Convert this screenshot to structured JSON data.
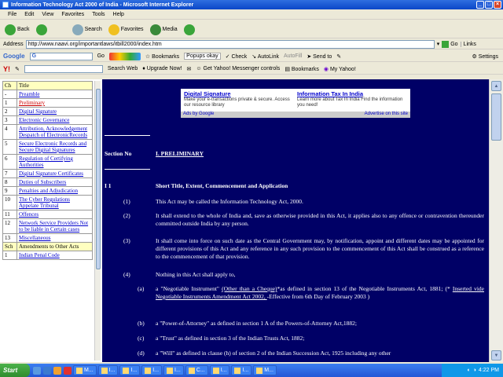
{
  "window": {
    "title": "Information Technology Act 2000 of India - Microsoft Internet Explorer"
  },
  "menu": [
    "File",
    "Edit",
    "View",
    "Favorites",
    "Tools",
    "Help"
  ],
  "toolbar": {
    "back": "Back",
    "search": "Search",
    "favorites": "Favorites",
    "media": "Media"
  },
  "address": {
    "label": "Address",
    "url": "http://www.naavi.org/importantlaws/itbill2000/index.htm",
    "go": "Go",
    "links": "Links"
  },
  "google_bar": {
    "brand": "Google",
    "input_prefix": "G",
    "go": "Go",
    "bookmarks": "Bookmarks",
    "popups": "Popups okay",
    "check": "Check",
    "autolink": "AutoLink",
    "autofill": "AutoFill",
    "sendto": "Send to",
    "settings": "Settings"
  },
  "yahoo_bar": {
    "brand": "Y!",
    "search_web": "Search Web",
    "upgrade": "Upgrade Now!",
    "messenger": "Get Yahoo! Messenger controls",
    "bookmarks": "Bookmarks",
    "my_yahoo": "My Yahoo!"
  },
  "toc": {
    "header": {
      "ch": "Ch",
      "title": "Title"
    },
    "rows": [
      {
        "n": "-",
        "title": "Preamble"
      },
      {
        "n": "1",
        "title": "Preliminary",
        "active": true
      },
      {
        "n": "2",
        "title": "Digital Signature"
      },
      {
        "n": "3",
        "title": "Electronic Governance"
      },
      {
        "n": "4",
        "title": "Attribution, Acknowledgement Despatch of ElectronicRecords"
      },
      {
        "n": "5",
        "title": "Secure Electronic Records and Secure Digital Signatures"
      },
      {
        "n": "6",
        "title": "Regulation of Certifying Authorities"
      },
      {
        "n": "7",
        "title": "Digital Signature Certificates"
      },
      {
        "n": "8",
        "title": "Duties of Subscribers"
      },
      {
        "n": "9",
        "title": "Penalties and Adjudication"
      },
      {
        "n": "10",
        "title": "The Cyber Regulations Appelate Tribunal"
      },
      {
        "n": "11",
        "title": "Offences"
      },
      {
        "n": "12",
        "title": "Network Service Providers Not to be liable in Certain cases"
      },
      {
        "n": "13",
        "title": "Miscellaneous"
      }
    ],
    "sch_header": {
      "ch": "Sch",
      "title": "Amendments to Other Acts"
    },
    "sch_rows": [
      {
        "n": "1",
        "title": "Indian Penal Code"
      }
    ]
  },
  "ad": {
    "left_title": "Digital Signature",
    "left_text": "Make your e-transactions private & secure. Access our resource library",
    "right_title": "Information Tax In India",
    "right_text": "Learn more about Tax In India Find the information you need!",
    "ads_by": "Ads by Google",
    "advertise": "Advertise on this site"
  },
  "section": {
    "label": "Section No",
    "title": "I. PRELIMINARY"
  },
  "clause": {
    "num": "I    1",
    "heading": "Short Title, Extent, Commencement and Application"
  },
  "paras": [
    {
      "num": "(1)",
      "text": "This Act may be called the Information Technology Act, 2000."
    },
    {
      "num": "(2)",
      "text": "It shall extend to the whole of India and, save as otherwise provided in this Act, it applies also to any offence or contravention thereunder committed outside India by any person."
    },
    {
      "num": "(3)",
      "text": "It shall come into force on such date as the Central Government may, by notification, appoint and different dates may be appointed for different provisions of this Act and any reference in any such provision to the commencement of this Act shall be construed as a reference to the commencement of that provision."
    },
    {
      "num": "(4)",
      "text": "Nothing in this Act shall apply to,"
    }
  ],
  "items": [
    {
      "num": "(a)",
      "pre": "a \"Negotiable Instrument\" ",
      "link": "(Other than a Cheque)",
      "mid": "*as defined in section 13 of the Negotiable Instruments Act, 1881; (* ",
      "link2": "Inserted vide Negotiable Instruments Amendment Act 2002, ",
      "post": "-Effective from 6th Day of February 2003 )"
    },
    {
      "num": "(b)",
      "text": "a \"Power-of-Attorney\" as defined in section 1 A of the Powers-of-Attorney   Act,1882;"
    },
    {
      "num": "(c)",
      "text": "a \"Trust\" as defined in section 3 of the Indian Trusts Act, 1882;"
    },
    {
      "num": "(d)",
      "text": "a \"Will\" as defined in clause (h) of section 2 of the Indian Succession Act,   1925 including any other"
    }
  ],
  "taskbar": {
    "start": "Start",
    "tasks": [
      "M...",
      "I...",
      "I...",
      "I...",
      "I...",
      "C...",
      "I...",
      "I...",
      "M..."
    ],
    "time": "4:22 PM"
  },
  "colors": {
    "page_bg": "#000066",
    "toc_header": "#ffffc0",
    "link": "#0000cc",
    "titlebar": "#0a46c8"
  }
}
